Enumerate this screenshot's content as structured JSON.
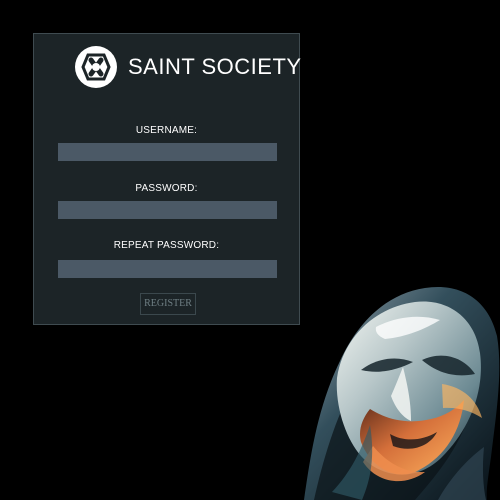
{
  "brand": {
    "title": "SAINT SOCIETY",
    "logo_icon": "cross-circle-icon"
  },
  "form": {
    "username": {
      "label": "USERNAME:",
      "value": "",
      "placeholder": ""
    },
    "password": {
      "label": "PASSWORD:",
      "value": "",
      "placeholder": ""
    },
    "repeat_password": {
      "label": "REPEAT PASSWORD:",
      "value": "",
      "placeholder": ""
    },
    "register_button": {
      "label": "REGISTER"
    }
  },
  "colors": {
    "background": "#000000",
    "panel": "#1c2427",
    "panel_border": "#3f4b50",
    "input": "#4b5966",
    "text": "#ffffff",
    "button_text": "#6f7f84"
  }
}
